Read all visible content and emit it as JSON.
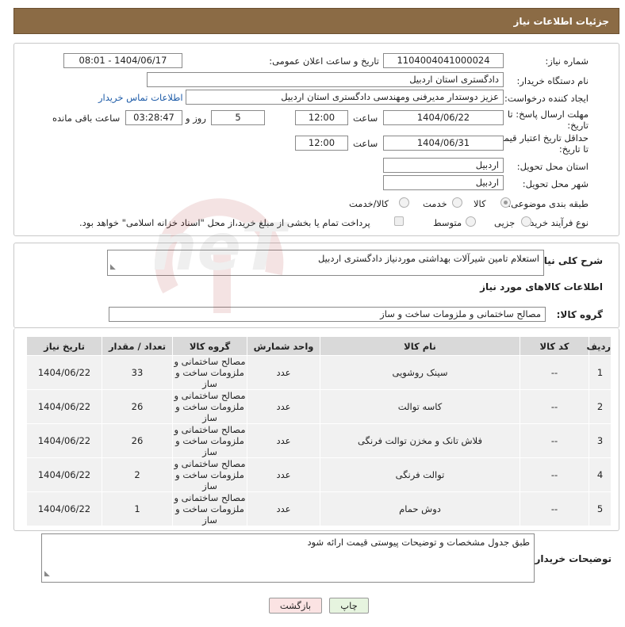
{
  "header": {
    "title": "جزئیات اطلاعات نیاز"
  },
  "form": {
    "need_number_label": "شماره نیاز:",
    "need_number": "1104004041000024",
    "announce_label": "تاریخ و ساعت اعلان عمومی:",
    "announce_value": "1404/06/17 - 08:01",
    "buyer_org_label": "نام دستگاه خریدار:",
    "buyer_org": "دادگستری استان اردبیل",
    "requester_label": "ایجاد کننده درخواست:",
    "requester": "عزیز دوستدار مدیرفنی ومهندسی  دادگستری استان اردبیل",
    "contact_link": "اطلاعات تماس خریدار",
    "deadline_label_1": "مهلت ارسال پاسخ: تا",
    "deadline_label_2": "تاریخ:",
    "deadline_date": "1404/06/22",
    "time_label": "ساعت",
    "deadline_time": "12:00",
    "days_value": "5",
    "days_label": "روز و",
    "remaining_time": "03:28:47",
    "remaining_label": "ساعت باقی مانده",
    "validity_label_1": "حداقل تاریخ اعتبار قیمت:",
    "validity_label_2": "تا تاریخ:",
    "validity_date": "1404/06/31",
    "validity_time": "12:00",
    "province_label": "استان محل تحویل:",
    "province": "اردبیل",
    "city_label": "شهر محل تحویل:",
    "city": "اردبیل",
    "category_label": "طبقه بندی موضوعی:",
    "category_options": [
      "کالا",
      "خدمت",
      "کالا/خدمت"
    ],
    "category_selected": "کالا",
    "process_label": "نوع فرآیند خرید :",
    "process_options": [
      "جزیی",
      "متوسط"
    ],
    "payment_note": "پرداخت تمام یا بخشی از مبلغ خرید،از محل \"اسناد خزانه اسلامی\" خواهد بود."
  },
  "description": {
    "label": "شرح کلی نیاز:",
    "text": "استعلام تامین شیرآلات بهداشتی موردنیاز دادگستری  اردبیل"
  },
  "goods": {
    "section_title": "اطلاعات کالاهای مورد نیاز",
    "group_label": "گروه کالا:",
    "group_value": "مصالح ساختمانی و ملزومات ساخت و ساز",
    "columns": [
      "ردیف",
      "کد کالا",
      "نام کالا",
      "واحد شمارش",
      "گروه کالا",
      "تعداد / مقدار",
      "تاریخ نیاز"
    ],
    "rows": [
      [
        "1",
        "--",
        "سینک روشویی",
        "عدد",
        "مصالح ساختمانی و ملزومات ساخت و ساز",
        "33",
        "1404/06/22"
      ],
      [
        "2",
        "--",
        "کاسه توالت",
        "عدد",
        "مصالح ساختمانی و ملزومات ساخت و ساز",
        "26",
        "1404/06/22"
      ],
      [
        "3",
        "--",
        "فلاش تانک و مخزن توالت فرنگی",
        "عدد",
        "مصالح ساختمانی و ملزومات ساخت و ساز",
        "26",
        "1404/06/22"
      ],
      [
        "4",
        "--",
        "توالت فرنگی",
        "عدد",
        "مصالح ساختمانی و ملزومات ساخت و ساز",
        "2",
        "1404/06/22"
      ],
      [
        "5",
        "--",
        "دوش حمام",
        "عدد",
        "مصالح ساختمانی و ملزومات ساخت و ساز",
        "1",
        "1404/06/22"
      ]
    ]
  },
  "buyer_notes": {
    "label": "توضیحات خریدار:",
    "text": "طبق جدول مشخصات و توضیحات پیوستی قیمت ارائه شود"
  },
  "buttons": {
    "print": "چاپ",
    "back": "بازگشت"
  },
  "watermark": "AriaTender.neT",
  "colors": {
    "header": "#8b6b45",
    "link": "#1d5ba8",
    "table_header": "#d9d9d9",
    "table_cell": "#f1f1f1"
  }
}
